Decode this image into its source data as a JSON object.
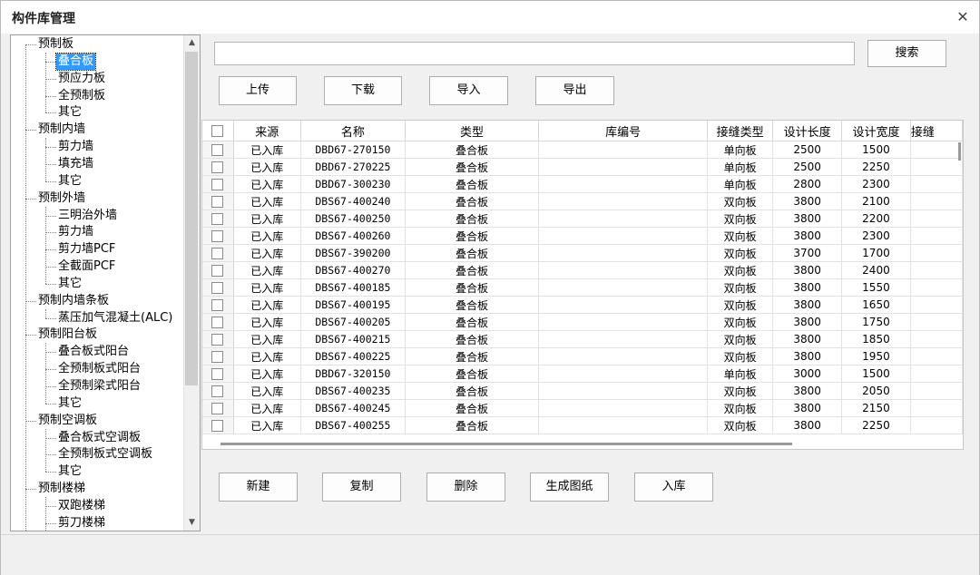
{
  "window": {
    "title": "构件库管理"
  },
  "tree": {
    "items": [
      {
        "label": "预制板",
        "level": 0
      },
      {
        "label": "叠合板",
        "level": 1,
        "selected": true
      },
      {
        "label": "预应力板",
        "level": 1
      },
      {
        "label": "全预制板",
        "level": 1
      },
      {
        "label": "其它",
        "level": 1
      },
      {
        "label": "预制内墙",
        "level": 0
      },
      {
        "label": "剪力墙",
        "level": 1
      },
      {
        "label": "填充墙",
        "level": 1
      },
      {
        "label": "其它",
        "level": 1
      },
      {
        "label": "预制外墙",
        "level": 0
      },
      {
        "label": "三明治外墙",
        "level": 1
      },
      {
        "label": "剪力墙",
        "level": 1
      },
      {
        "label": "剪力墙PCF",
        "level": 1
      },
      {
        "label": "全截面PCF",
        "level": 1
      },
      {
        "label": "其它",
        "level": 1
      },
      {
        "label": "预制内墙条板",
        "level": 0
      },
      {
        "label": "蒸压加气混凝土(ALC)",
        "level": 1
      },
      {
        "label": "预制阳台板",
        "level": 0
      },
      {
        "label": "叠合板式阳台",
        "level": 1
      },
      {
        "label": "全预制板式阳台",
        "level": 1
      },
      {
        "label": "全预制梁式阳台",
        "level": 1
      },
      {
        "label": "其它",
        "level": 1
      },
      {
        "label": "预制空调板",
        "level": 0
      },
      {
        "label": "叠合板式空调板",
        "level": 1
      },
      {
        "label": "全预制板式空调板",
        "level": 1
      },
      {
        "label": "其它",
        "level": 1
      },
      {
        "label": "预制楼梯",
        "level": 0
      },
      {
        "label": "双跑楼梯",
        "level": 1
      },
      {
        "label": "剪刀楼梯",
        "level": 1
      }
    ]
  },
  "search": {
    "value": "",
    "button": "搜索"
  },
  "toolbar": {
    "upload": "上传",
    "download": "下载",
    "import": "导入",
    "export": "导出"
  },
  "table": {
    "columns": [
      "来源",
      "名称",
      "类型",
      "库编号",
      "接缝类型",
      "设计长度",
      "设计宽度",
      "接缝"
    ],
    "rows": [
      [
        "已入库",
        "DBD67-270150",
        "叠合板",
        "",
        "单向板",
        "2500",
        "1500",
        ""
      ],
      [
        "已入库",
        "DBD67-270225",
        "叠合板",
        "",
        "单向板",
        "2500",
        "2250",
        ""
      ],
      [
        "已入库",
        "DBD67-300230",
        "叠合板",
        "",
        "单向板",
        "2800",
        "2300",
        ""
      ],
      [
        "已入库",
        "DBS67-400240",
        "叠合板",
        "",
        "双向板",
        "3800",
        "2100",
        ""
      ],
      [
        "已入库",
        "DBS67-400250",
        "叠合板",
        "",
        "双向板",
        "3800",
        "2200",
        ""
      ],
      [
        "已入库",
        "DBS67-400260",
        "叠合板",
        "",
        "双向板",
        "3800",
        "2300",
        ""
      ],
      [
        "已入库",
        "DBS67-390200",
        "叠合板",
        "",
        "双向板",
        "3700",
        "1700",
        ""
      ],
      [
        "已入库",
        "DBS67-400270",
        "叠合板",
        "",
        "双向板",
        "3800",
        "2400",
        ""
      ],
      [
        "已入库",
        "DBS67-400185",
        "叠合板",
        "",
        "双向板",
        "3800",
        "1550",
        ""
      ],
      [
        "已入库",
        "DBS67-400195",
        "叠合板",
        "",
        "双向板",
        "3800",
        "1650",
        ""
      ],
      [
        "已入库",
        "DBS67-400205",
        "叠合板",
        "",
        "双向板",
        "3800",
        "1750",
        ""
      ],
      [
        "已入库",
        "DBS67-400215",
        "叠合板",
        "",
        "双向板",
        "3800",
        "1850",
        ""
      ],
      [
        "已入库",
        "DBS67-400225",
        "叠合板",
        "",
        "双向板",
        "3800",
        "1950",
        ""
      ],
      [
        "已入库",
        "DBD67-320150",
        "叠合板",
        "",
        "单向板",
        "3000",
        "1500",
        ""
      ],
      [
        "已入库",
        "DBS67-400235",
        "叠合板",
        "",
        "双向板",
        "3800",
        "2050",
        ""
      ],
      [
        "已入库",
        "DBS67-400245",
        "叠合板",
        "",
        "双向板",
        "3800",
        "2150",
        ""
      ],
      [
        "已入库",
        "DBS67-400255",
        "叠合板",
        "",
        "双向板",
        "3800",
        "2250",
        ""
      ]
    ]
  },
  "actions": {
    "new": "新建",
    "copy": "复制",
    "delete": "删除",
    "generate_drawing": "生成图纸",
    "store": "入库"
  }
}
